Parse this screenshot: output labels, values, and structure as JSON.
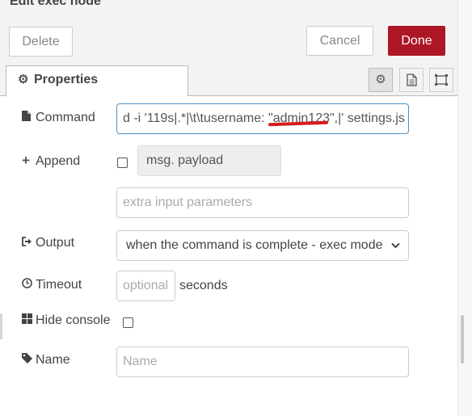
{
  "header": {
    "title": "Edit exec node"
  },
  "toolbar": {
    "delete_label": "Delete",
    "cancel_label": "Cancel",
    "done_label": "Done"
  },
  "tabs": {
    "properties_label": "Properties"
  },
  "form": {
    "command": {
      "label": "Command",
      "value": "d -i '119s|.*|\\t\\tusername: \"admin123\",|'  settings.js"
    },
    "append": {
      "label": "Append",
      "typed_value": "msg. payload",
      "checked": false,
      "extra_placeholder": "extra input parameters"
    },
    "output": {
      "label": "Output",
      "selected": "when the command is complete - exec mode"
    },
    "timeout": {
      "label": "Timeout",
      "placeholder": "optional",
      "unit": "seconds"
    },
    "hide_console": {
      "label": "Hide console",
      "checked": false
    },
    "name": {
      "label": "Name",
      "placeholder": "Name"
    }
  },
  "colors": {
    "done_button": "#ad1625",
    "focus_border": "#4a90c2",
    "annotation_underline": "#d61b1b"
  },
  "icons": [
    "gear-icon",
    "document-icon",
    "frame-icon",
    "file-icon",
    "plus-icon",
    "sign-out-icon",
    "clock-icon",
    "windows-icon",
    "tag-icon",
    "chevron-down-icon"
  ]
}
